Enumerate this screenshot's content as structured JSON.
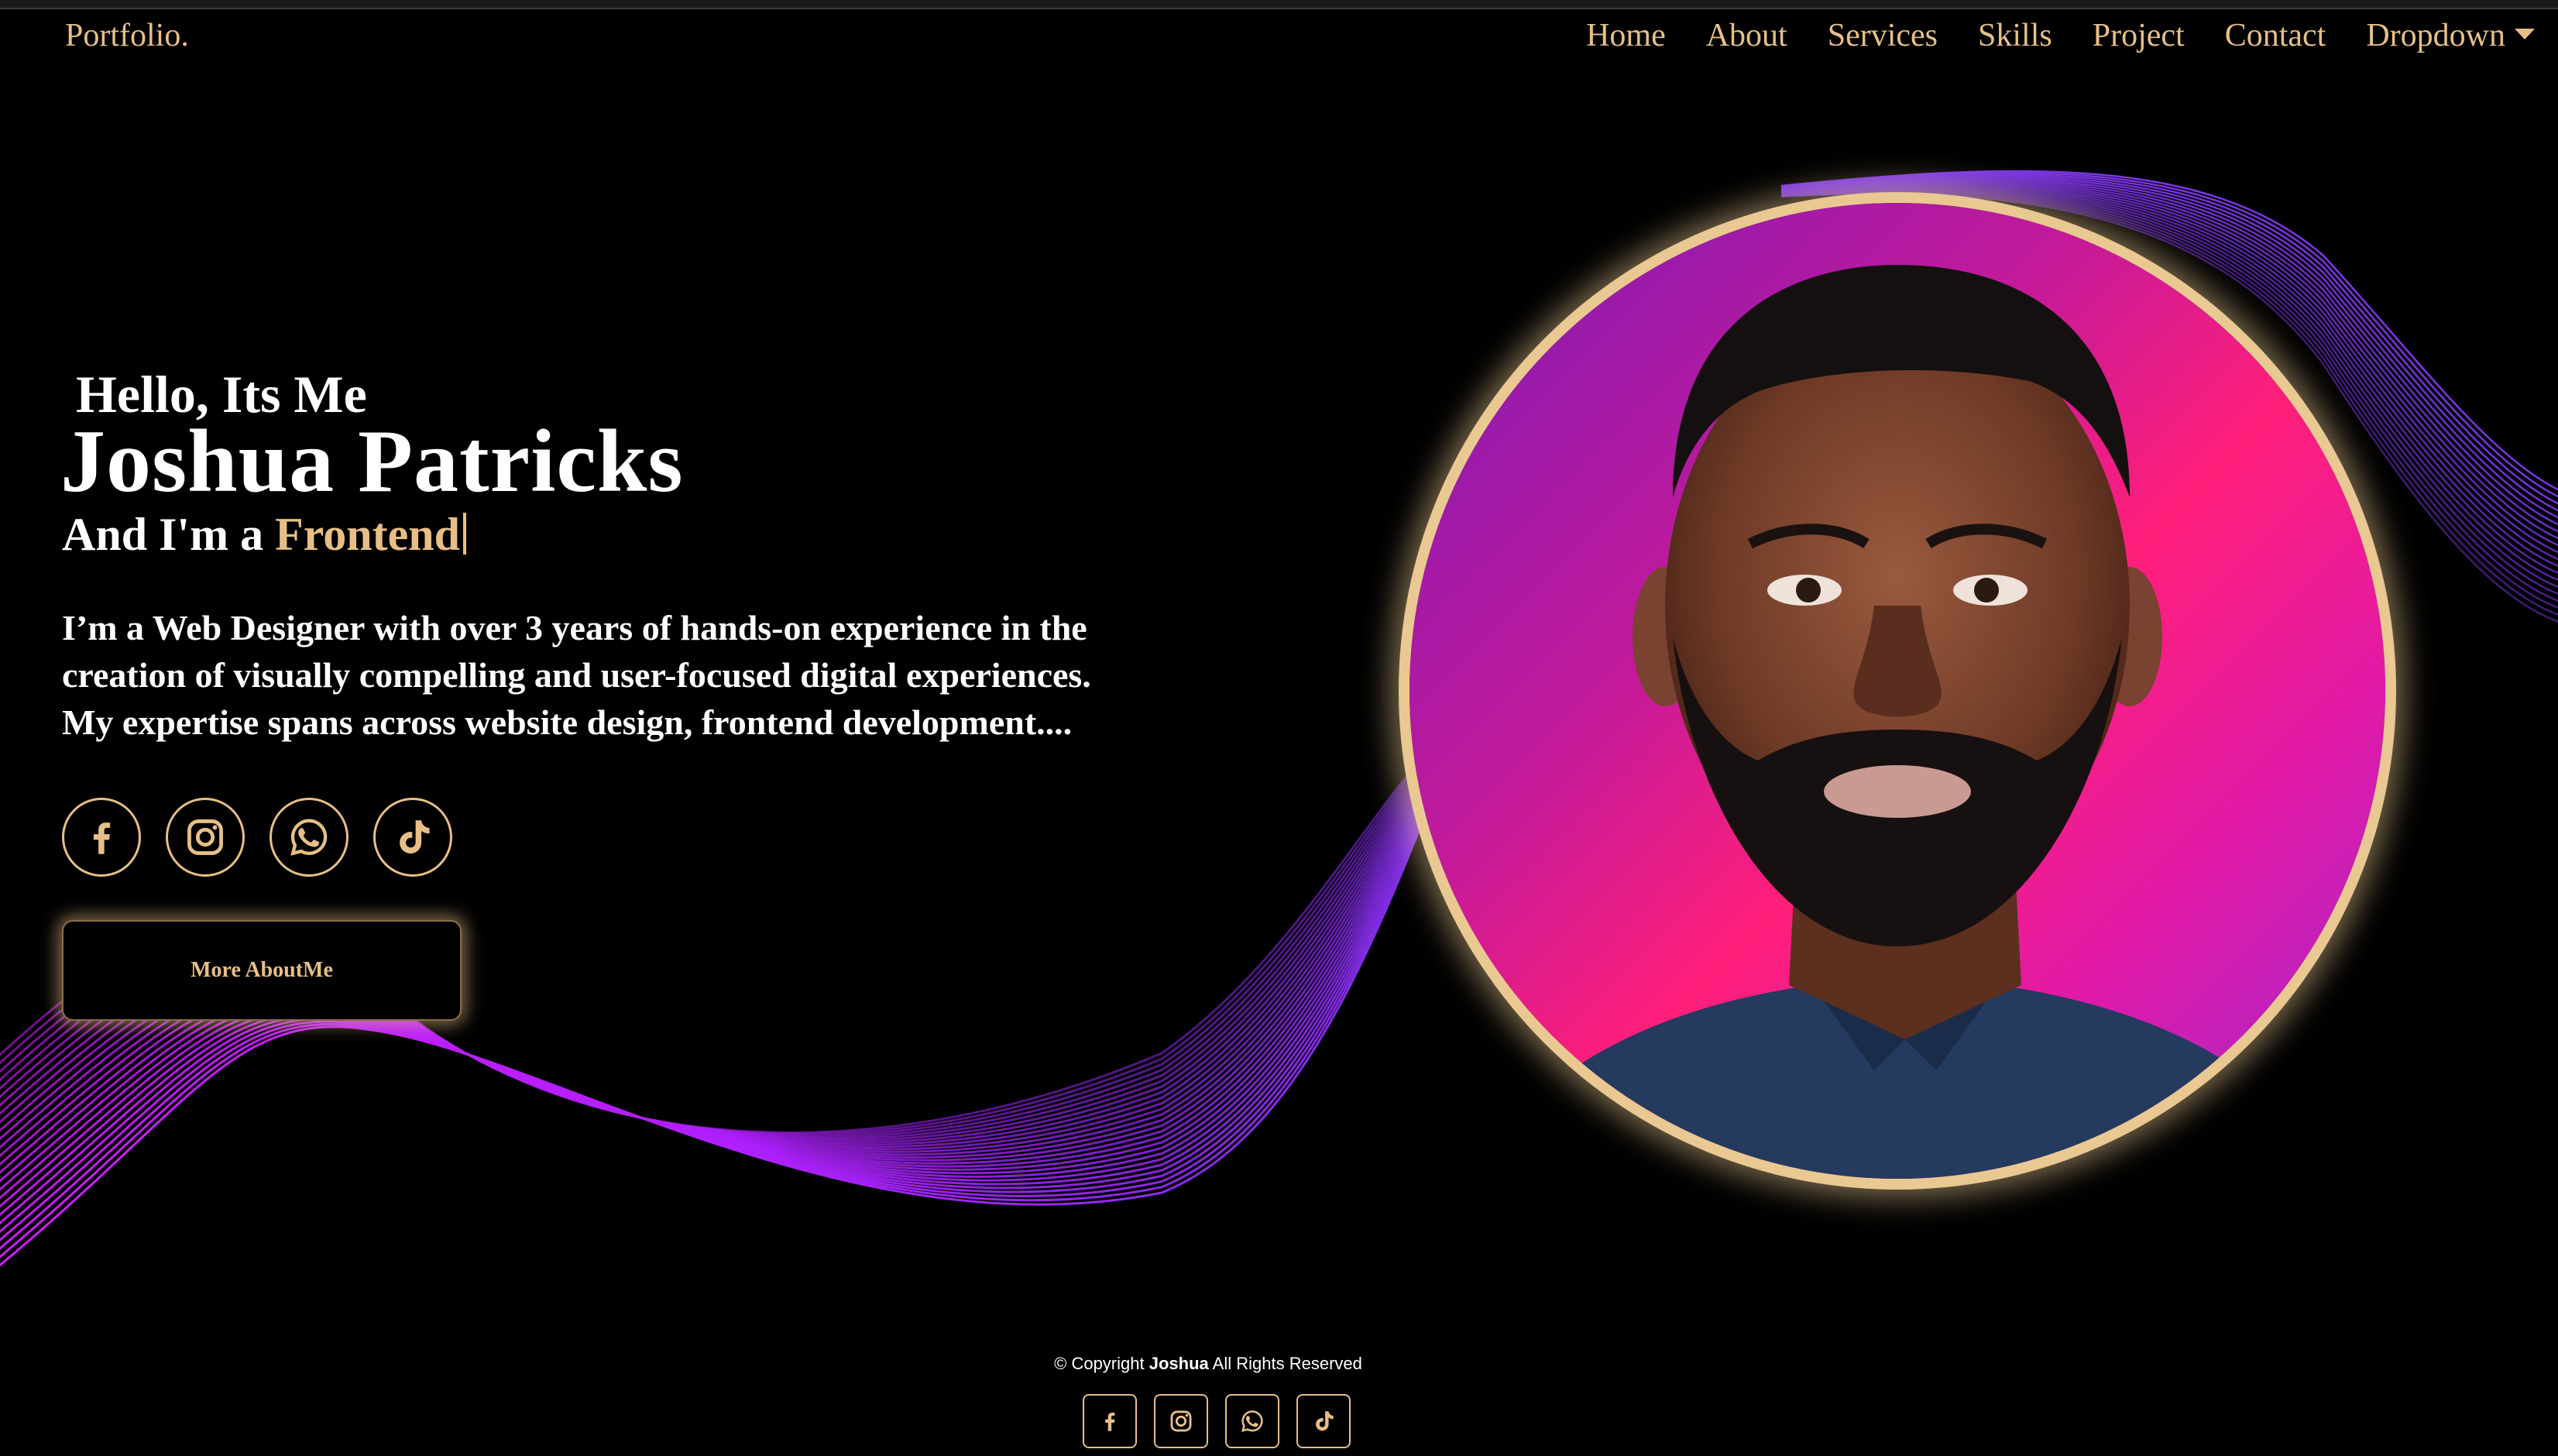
{
  "brand": {
    "logo": "Portfolio."
  },
  "nav": {
    "items": [
      "Home",
      "About",
      "Services",
      "Skills",
      "Project",
      "Contact",
      "Dropdown"
    ]
  },
  "hero": {
    "greeting": "Hello, Its Me",
    "name": "Joshua Patricks",
    "role_prefix": "And I'm a",
    "role_typed": "Frontend",
    "bio_lines": [
      "I’m a Web Designer with over 3 years of hands-on experience in the",
      "creation of visually compelling and user-focused digital experiences.",
      "My expertise spans across website design, frontend development...."
    ],
    "button_label": "More AboutMe"
  },
  "socials": [
    {
      "icon": "facebook-icon"
    },
    {
      "icon": "instagram-icon"
    },
    {
      "icon": "whatsapp-icon"
    },
    {
      "icon": "tiktok-icon"
    }
  ],
  "footer": {
    "copyright_prefix": "© Copyright",
    "copyright_name": "Joshua",
    "copyright_suffix": "All Rights Reserved"
  },
  "colors": {
    "accent": "#e7bf86",
    "background": "#000000",
    "wave": "#c21aff",
    "portrait_gradient": [
      "#7d1bb5",
      "#ff1f7a",
      "#9b2ad1"
    ]
  }
}
